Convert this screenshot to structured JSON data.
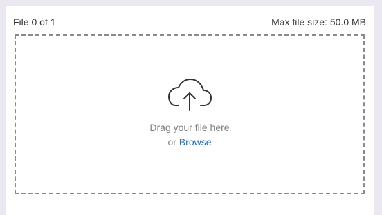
{
  "header": {
    "file_count": "File 0 of 1",
    "max_size": "Max file size: 50.0 MB"
  },
  "dropzone": {
    "icon": "cloud-upload-icon",
    "drag_text": "Drag your file here",
    "or_text": "or",
    "browse_label": "Browse"
  },
  "colors": {
    "page_background": "#ece8f1",
    "panel_background": "#ffffff",
    "dashed_border": "#8a8a8a",
    "link": "#1f6fd1"
  }
}
